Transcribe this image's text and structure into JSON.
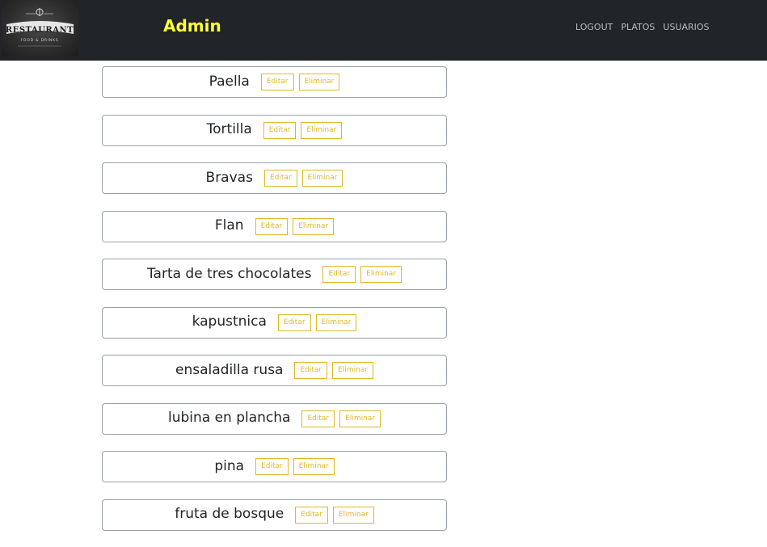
{
  "navbar": {
    "logo": {
      "text_main": "RESTAURANT",
      "text_sub": "FOOD & DRINKS"
    },
    "brand": "Admin",
    "links": [
      {
        "label": "LOGOUT"
      },
      {
        "label": "PLATOS"
      },
      {
        "label": "USUARIOS"
      }
    ]
  },
  "dishes": [
    {
      "name": "Paella",
      "edit_label": "Editar",
      "delete_label": "Eliminar"
    },
    {
      "name": "Tortilla",
      "edit_label": "Editar",
      "delete_label": "Eliminar"
    },
    {
      "name": "Bravas",
      "edit_label": "Editar",
      "delete_label": "Eliminar"
    },
    {
      "name": "Flan",
      "edit_label": "Editar",
      "delete_label": "Eliminar"
    },
    {
      "name": "Tarta de tres chocolates",
      "edit_label": "Editar",
      "delete_label": "Eliminar"
    },
    {
      "name": "kapustnica",
      "edit_label": "Editar",
      "delete_label": "Eliminar"
    },
    {
      "name": "ensaladilla rusa",
      "edit_label": "Editar",
      "delete_label": "Eliminar"
    },
    {
      "name": "lubina en plancha",
      "edit_label": "Editar",
      "delete_label": "Eliminar"
    },
    {
      "name": "pina",
      "edit_label": "Editar",
      "delete_label": "Eliminar"
    },
    {
      "name": "fruta de bosque",
      "edit_label": "Editar",
      "delete_label": "Eliminar"
    }
  ],
  "colors": {
    "navbar_bg": "#212529",
    "brand": "#ffff33",
    "button_accent": "#e0b72a",
    "card_border": "#9aa0a6"
  }
}
